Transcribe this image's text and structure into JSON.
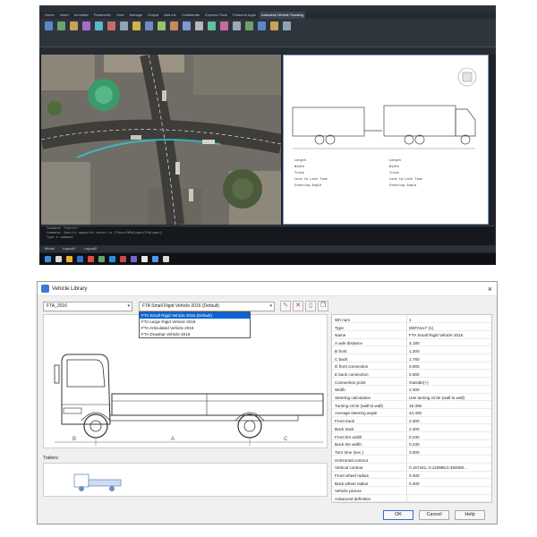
{
  "cad": {
    "menu": [
      "Home",
      "Insert",
      "Annotate",
      "Parametric",
      "View",
      "Manage",
      "Output",
      "Add-ins",
      "Collaborate",
      "Express Tools",
      "Featured Apps",
      "Autodesk Vehicle Tracking"
    ],
    "active_menu_index": 11,
    "cmd_lines": [
      "Command: *Cancel*",
      "Command: Specify opposite corner or [Fence/WPolygon/CPolygon]:",
      "Type a command"
    ],
    "status_tabs": [
      "Model",
      "Layout1",
      "Layout2"
    ],
    "drawing_notes_left": [
      "Length",
      "Width",
      "Track",
      "Lock to Lock Time",
      "Steering Angle"
    ],
    "drawing_notes_right": [
      "Length",
      "Width",
      "Track",
      "Lock to Lock Time",
      "Steering Angle"
    ]
  },
  "dialog": {
    "title": "Vehicle Library",
    "close_glyph": "×",
    "library_value": "FTA_2016",
    "vehicle_value": "FTA Small Rigid Vehicle 2016 (Default)",
    "vehicle_options": [
      "FTA Small Rigid Vehicle 2016 (Default)",
      "FTA Large Rigid Vehicle 2016",
      "FTA Articulated Vehicle 2016",
      "FTA Drawbar Vehicle 2016"
    ],
    "selected_option_index": 0,
    "trailers_label": "Trailers:",
    "properties": [
      {
        "name": "Wh num",
        "value": "1"
      },
      {
        "name": "Type",
        "value": "DEFAULT (1)"
      },
      {
        "name": "Name",
        "value": "FTA Small Rigid Vehicle 2016"
      },
      {
        "name": "A axle distance",
        "value": "4.180"
      },
      {
        "name": "B front",
        "value": "1.200"
      },
      {
        "name": "C back",
        "value": "1.780"
      },
      {
        "name": "D front connection",
        "value": "0.000"
      },
      {
        "name": "E back connection",
        "value": "0.000"
      },
      {
        "name": "Connection point",
        "value": "Outside(+)"
      },
      {
        "name": "Width",
        "value": "2.300"
      },
      {
        "name": "Steering calculation",
        "value": "Use turning circle (wall to wall)"
      },
      {
        "name": "Turning circle (wall to wall)",
        "value": "15.300"
      },
      {
        "name": "Average steering angle",
        "value": "44.400"
      },
      {
        "name": "Front track",
        "value": "2.300"
      },
      {
        "name": "Back track",
        "value": "2.300"
      },
      {
        "name": "Front tire width",
        "value": "0.230"
      },
      {
        "name": "Back tire width",
        "value": "0.230"
      },
      {
        "name": "Turn time (sec.)",
        "value": "3.000"
      },
      {
        "name": "Horizontal contour",
        "value": ""
      },
      {
        "name": "Vertical contour",
        "value": "0.157441,-0.110988,0.393350..."
      },
      {
        "name": "Front wheel radius",
        "value": "0.400"
      },
      {
        "name": "Back wheel radius",
        "value": "0.400"
      },
      {
        "name": "Vehicle picture",
        "value": ""
      },
      {
        "name": "Advanced definition",
        "value": ""
      }
    ],
    "dim_labels": [
      "B",
      "A",
      "C"
    ],
    "buttons": {
      "ok": "OK",
      "cancel": "Cancel",
      "help": "Help"
    },
    "colors": {
      "selection": "#0a64d6",
      "accent": "#3b7bd6"
    }
  }
}
